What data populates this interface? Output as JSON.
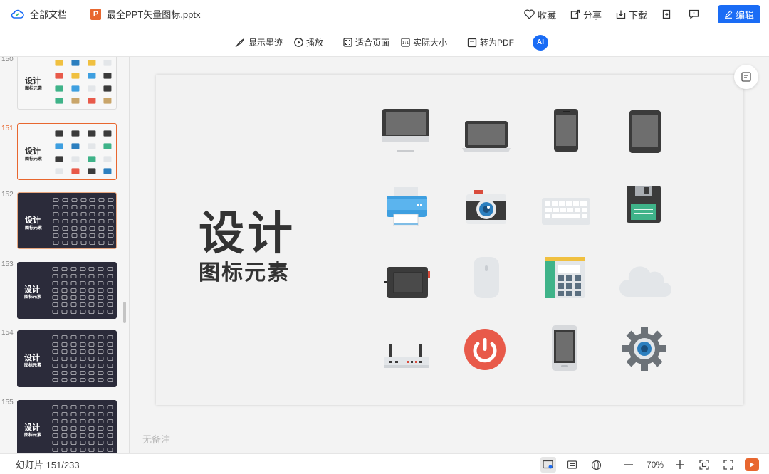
{
  "topbar": {
    "docs_label": "全部文档",
    "file_badge": "P",
    "file_name": "最全PPT矢量图标.pptx",
    "favorite": "收藏",
    "share": "分享",
    "download": "下载",
    "edit": "编辑"
  },
  "toolbar": {
    "ink": "显示墨迹",
    "play": "播放",
    "fit_page": "适合页面",
    "actual_size": "实际大小",
    "to_pdf": "转为PDF",
    "ai": "AI"
  },
  "sidebar": {
    "slides": [
      {
        "num": "150",
        "title": "设计",
        "subtitle": "图标元素",
        "style": "light",
        "state": ""
      },
      {
        "num": "151",
        "title": "设计",
        "subtitle": "图标元素",
        "style": "light",
        "state": "selected"
      },
      {
        "num": "152",
        "title": "设计",
        "subtitle": "图标元素",
        "style": "dark",
        "state": "hover"
      },
      {
        "num": "153",
        "title": "设计",
        "subtitle": "图标元素",
        "style": "dark",
        "state": ""
      },
      {
        "num": "154",
        "title": "设计",
        "subtitle": "图标元素",
        "style": "dark",
        "state": ""
      },
      {
        "num": "155",
        "title": "设计",
        "subtitle": "图标元素",
        "style": "dark",
        "state": ""
      }
    ]
  },
  "slide": {
    "title": "设计",
    "subtitle": "图标元素",
    "icons": [
      "monitor-icon",
      "laptop-icon",
      "phone-icon",
      "tablet-icon",
      "printer-icon",
      "camera-icon",
      "keyboard-icon",
      "floppy-disk-icon",
      "drawing-tablet-icon",
      "mouse-icon",
      "calculator-icon",
      "cloud-icon",
      "router-icon",
      "power-icon",
      "smartphone-icon",
      "gear-icon"
    ]
  },
  "notes": "无备注",
  "status": {
    "slide_counter": "幻灯片 151/233",
    "zoom": "70%"
  },
  "colors": {
    "accent": "#1a6cf5",
    "brand_orange": "#e8672f"
  }
}
